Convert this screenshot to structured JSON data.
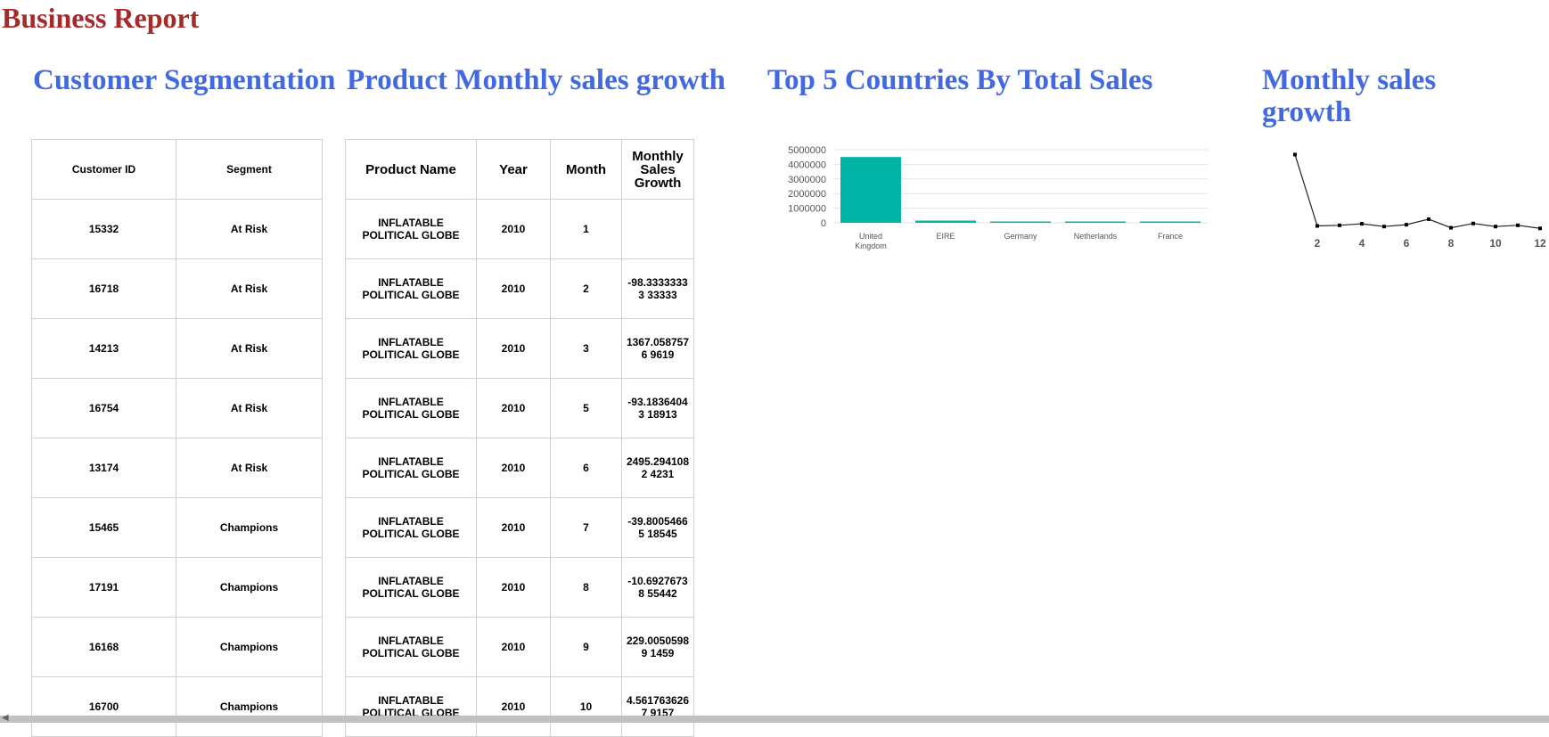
{
  "report_title": "Business Report",
  "sections": {
    "customer": "Customer Segmentation",
    "product": "Product Monthly sales growth",
    "countries": "Top 5 Countries By Total Sales",
    "monthly": "Monthly sales growth"
  },
  "customer_table": {
    "headers": [
      "Customer ID",
      "Segment"
    ],
    "rows": [
      [
        "15332",
        "At Risk"
      ],
      [
        "16718",
        "At Risk"
      ],
      [
        "14213",
        "At Risk"
      ],
      [
        "16754",
        "At Risk"
      ],
      [
        "13174",
        "At Risk"
      ],
      [
        "15465",
        "Champions"
      ],
      [
        "17191",
        "Champions"
      ],
      [
        "16168",
        "Champions"
      ],
      [
        "16700",
        "Champions"
      ]
    ]
  },
  "product_table": {
    "headers": [
      "Product Name",
      "Year",
      "Month",
      "Monthly Sales Growth"
    ],
    "rows": [
      [
        "INFLATABLE POLITICAL GLOBE",
        "2010",
        "1",
        ""
      ],
      [
        "INFLATABLE POLITICAL GLOBE",
        "2010",
        "2",
        "-98.33333333 33333"
      ],
      [
        "INFLATABLE POLITICAL GLOBE",
        "2010",
        "3",
        "1367.0587576 9619"
      ],
      [
        "INFLATABLE POLITICAL GLOBE",
        "2010",
        "5",
        "-93.18364043 18913"
      ],
      [
        "INFLATABLE POLITICAL GLOBE",
        "2010",
        "6",
        "2495.2941082 4231"
      ],
      [
        "INFLATABLE POLITICAL GLOBE",
        "2010",
        "7",
        "-39.80054665 18545"
      ],
      [
        "INFLATABLE POLITICAL GLOBE",
        "2010",
        "8",
        "-10.69276738 55442"
      ],
      [
        "INFLATABLE POLITICAL GLOBE",
        "2010",
        "9",
        "229.00505989 1459"
      ],
      [
        "INFLATABLE POLITICAL GLOBE",
        "2010",
        "10",
        "4.5617636267 9157"
      ]
    ]
  },
  "chart_data": [
    {
      "type": "bar",
      "categories": [
        "United Kingdom",
        "EIRE",
        "Germany",
        "Netherlands",
        "France"
      ],
      "values": [
        4500000,
        150000,
        50000,
        40000,
        30000
      ],
      "ylim": [
        0,
        5000000
      ],
      "yticks": [
        "5000000",
        "4000000",
        "3000000",
        "2000000",
        "1000000",
        "0"
      ],
      "grid": true,
      "color": "#00b5a5"
    },
    {
      "type": "line",
      "x": [
        1,
        2,
        3,
        4,
        5,
        6,
        7,
        8,
        9,
        10,
        11,
        12
      ],
      "y": [
        2300,
        -20,
        0,
        50,
        -40,
        20,
        200,
        -80,
        60,
        -40,
        0,
        -100
      ],
      "xticks": [
        "2",
        "4",
        "6",
        "8",
        "10",
        "12"
      ],
      "ylim": [
        -150,
        2400
      ],
      "color": "#222222"
    }
  ]
}
